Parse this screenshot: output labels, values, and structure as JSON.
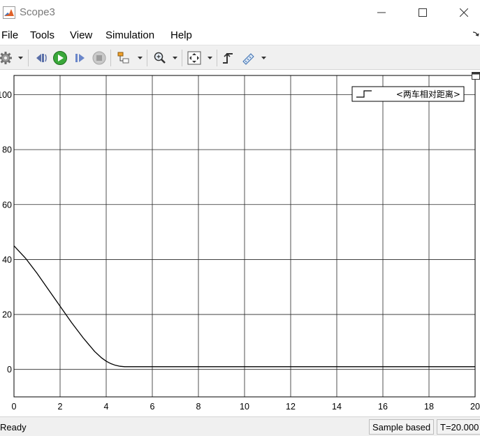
{
  "window": {
    "title": "Scope3"
  },
  "menu": [
    "File",
    "Tools",
    "View",
    "Simulation",
    "Help"
  ],
  "toolbar": {
    "icons": [
      "settings-icon",
      "step-back-icon",
      "run-icon",
      "step-forward-icon",
      "stop-icon",
      "signal-selector-icon",
      "zoom-icon",
      "fit-to-view-icon",
      "triggers-icon",
      "measurements-icon"
    ]
  },
  "colors": {
    "line": "#000000",
    "grid": "#262626",
    "toolbar_bg": "#f0f0f0",
    "run_green": "#2e9b2e"
  },
  "chart_data": {
    "type": "line",
    "title": "",
    "xlabel": "",
    "ylabel": "",
    "xlim": [
      0,
      20
    ],
    "ylim": [
      -10,
      107
    ],
    "xticks": [
      0,
      2,
      4,
      6,
      8,
      10,
      12,
      14,
      16,
      18,
      20
    ],
    "yticks": [
      0,
      20,
      40,
      60,
      80,
      100
    ],
    "xtick_labels": [
      "0",
      "2",
      "4",
      "6",
      "8",
      "10",
      "12",
      "14",
      "16",
      "18",
      "20"
    ],
    "ytick_labels": [
      "0",
      "20",
      "40",
      "60",
      "80",
      "100"
    ],
    "grid": true,
    "legend": {
      "placement": "top-right"
    },
    "series": [
      {
        "name": "<两车相对距离>",
        "color": "#000000",
        "x": [
          0,
          0.5,
          1.0,
          1.5,
          2.0,
          2.5,
          3.0,
          3.5,
          3.8,
          4.0,
          4.2,
          4.4,
          4.6,
          4.8,
          5.0,
          5.5,
          6,
          8,
          10,
          12,
          14,
          16,
          18,
          20
        ],
        "y": [
          45,
          40.5,
          35,
          29,
          23,
          17,
          11.5,
          6.5,
          4.2,
          3.0,
          2.1,
          1.5,
          1.15,
          1.0,
          1.0,
          1.0,
          1.0,
          1.0,
          1.0,
          1.0,
          1.0,
          1.0,
          1.0,
          1.0
        ]
      }
    ]
  },
  "status": {
    "ready": "Ready",
    "sample": "Sample based",
    "time": "T=20.000"
  }
}
